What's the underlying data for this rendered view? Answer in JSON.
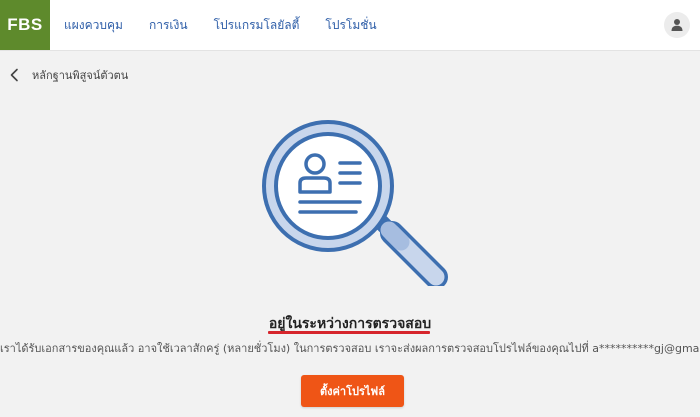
{
  "header": {
    "logo_text": "FBS",
    "nav": [
      {
        "label": "แผงควบคุม"
      },
      {
        "label": "การเงิน"
      },
      {
        "label": "โปรแกรมโลยัลตี้"
      },
      {
        "label": "โปรโมชั่น"
      }
    ],
    "avatar_icon": "user-icon"
  },
  "page": {
    "back_icon": "chevron-left-icon",
    "title": "หลักฐานพิสูจน์ตัวตน"
  },
  "status": {
    "illustration": "magnifier-document-icon",
    "heading": "อยู่ในระหว่างการตรวจสอบ",
    "description": "เราได้รับเอกสารของคุณแล้ว อาจใช้เวลาสักครู่ (หลายชั่วโมง) ในการตรวจสอบ เราจะส่งผลการตรวจสอบโปรไฟล์ของคุณไปที่ a**********gj@gmail.com",
    "button_label": "ตั้งค่าโปรไฟล์"
  },
  "colors": {
    "brand_green": "#5e8a2c",
    "link_blue": "#2e5ea8",
    "accent_orange": "#ef5516",
    "underline_red": "#d6252c",
    "illustration_blue": "#3d6fb0"
  }
}
